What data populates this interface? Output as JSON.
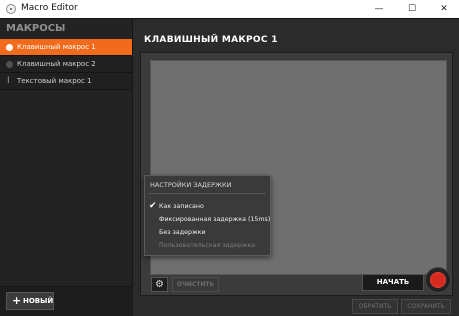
{
  "window": {
    "title": "Macro Editor"
  },
  "sidebar": {
    "header": "МАКРОСЫ",
    "items": [
      {
        "label": "Клавишный макрос 1",
        "icon": "dot-icon"
      },
      {
        "label": "Клавишный макрос 2",
        "icon": "dot-icon"
      },
      {
        "label": "Текстовый макрос 1",
        "icon": "text-cursor-icon"
      }
    ],
    "new_button": "НОВЫЙ"
  },
  "main": {
    "title": "КЛАВИШНЫЙ МАКРОС 1",
    "clear_button": "ОЧИСТИТЬ",
    "start_button": "НАЧАТЬ",
    "cancel_button": "ОБРАТИТЬ",
    "save_button": "СОХРАНИТЬ"
  },
  "delay_menu": {
    "title": "НАСТРОЙКИ ЗАДЕРЖКИ",
    "items": [
      {
        "label": "Как записано",
        "checked": true,
        "enabled": true
      },
      {
        "label": "Фиксированная задержка (15ms)",
        "checked": false,
        "enabled": true
      },
      {
        "label": "Без задержки",
        "checked": false,
        "enabled": true
      },
      {
        "label": "Пользовательская задержка",
        "checked": false,
        "enabled": false
      }
    ]
  },
  "colors": {
    "accent": "#f26a1b",
    "record": "#d52a1f",
    "background": "#2b2b2b"
  }
}
